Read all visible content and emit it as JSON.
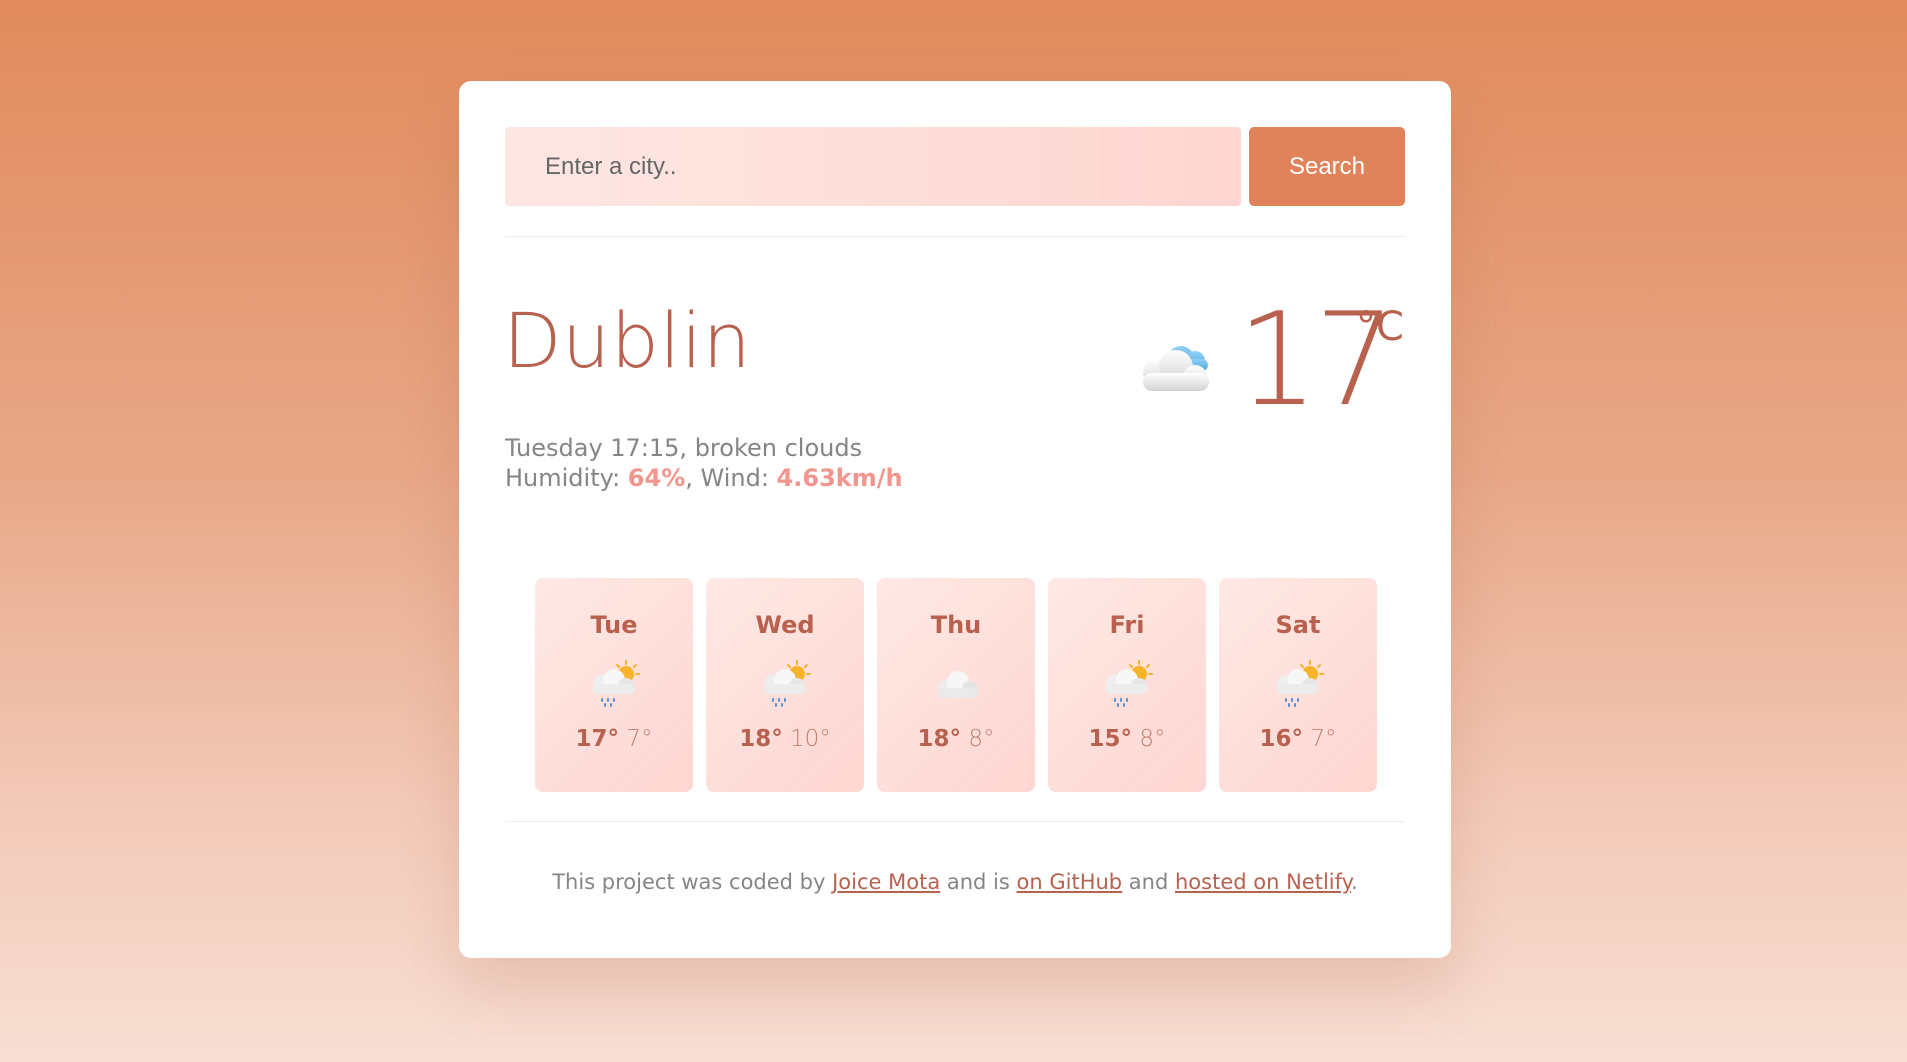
{
  "search": {
    "placeholder": "Enter a city..",
    "button_label": "Search"
  },
  "current": {
    "city": "Dublin",
    "temperature": "17",
    "unit": "°C",
    "day_time_description": "Tuesday 17:15, broken clouds",
    "humidity_label": "Humidity: ",
    "humidity_value": "64%",
    "wind_label": ", Wind: ",
    "wind_value": "4.63km/h",
    "icon": "broken-clouds-icon"
  },
  "forecast": [
    {
      "day": "Tue",
      "max": "17°",
      "min": "7°",
      "icon": "rain-sun-icon"
    },
    {
      "day": "Wed",
      "max": "18°",
      "min": "10°",
      "icon": "rain-sun-icon"
    },
    {
      "day": "Thu",
      "max": "18°",
      "min": "8°",
      "icon": "cloud-icon"
    },
    {
      "day": "Fri",
      "max": "15°",
      "min": "8°",
      "icon": "rain-sun-icon"
    },
    {
      "day": "Sat",
      "max": "16°",
      "min": "7°",
      "icon": "rain-sun-icon"
    }
  ],
  "footer": {
    "text_1": "This project was coded by ",
    "author_link": "Joice Mota",
    "text_2": " and is ",
    "github_link": "on GitHub",
    "text_3": " and ",
    "netlify_link": "hosted on Netlify",
    "text_4": "."
  },
  "colors": {
    "accent": "#e0835a",
    "text_primary": "#b9614f",
    "highlight": "#f2958d",
    "card_bg": "#ffd6d1"
  }
}
